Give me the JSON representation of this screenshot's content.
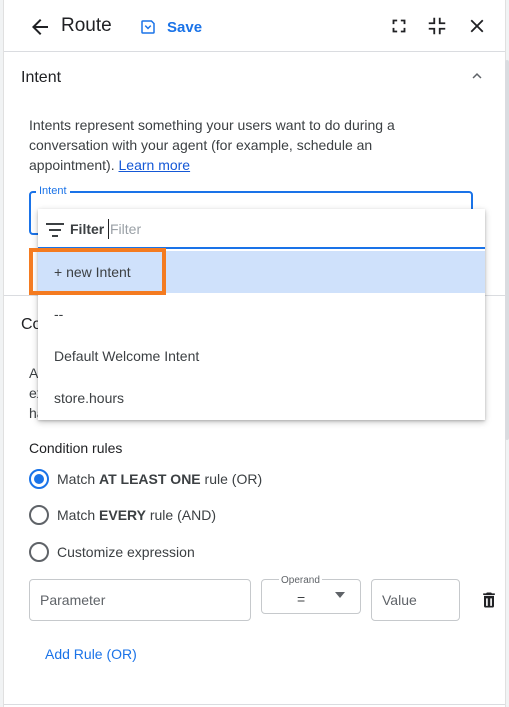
{
  "header": {
    "title": "Route",
    "save_label": "Save"
  },
  "intent_section": {
    "title": "Intent",
    "description": "Intents represent something your users want to do during a conversation with your agent (for example, schedule an appointment).",
    "learn_more": "Learn more",
    "field_label": "Intent"
  },
  "dropdown": {
    "filter_label": "Filter",
    "filter_placeholder": "Filter",
    "items": [
      {
        "label": "+ new Intent",
        "selected": true
      },
      {
        "label": "--"
      },
      {
        "label": "Default Welcome Intent"
      },
      {
        "label": "store.hours"
      }
    ]
  },
  "condition_section": {
    "title_visible": "Co",
    "desc_fragments": [
      "A",
      "ex",
      "ha"
    ],
    "rules_label": "Condition rules",
    "options": [
      {
        "prefix": "Match ",
        "bold": "AT LEAST ONE",
        "suffix": " rule (OR)",
        "checked": true
      },
      {
        "prefix": "Match ",
        "bold": "EVERY",
        "suffix": " rule (AND)",
        "checked": false
      },
      {
        "prefix": "Customize expression",
        "bold": "",
        "suffix": "",
        "checked": false
      }
    ],
    "parameter_placeholder": "Parameter",
    "operand_label": "Operand",
    "operand_value": "=",
    "value_placeholder": "Value",
    "add_rule_label": "Add Rule (OR)"
  },
  "colors": {
    "accent": "#1a73e8",
    "highlight": "#f47b20",
    "selected_bg": "#cfe1fb"
  }
}
